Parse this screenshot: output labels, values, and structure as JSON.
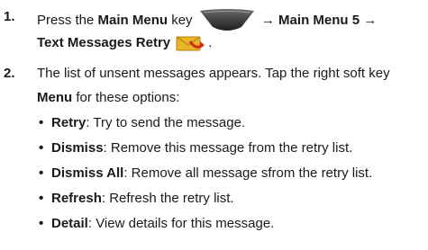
{
  "steps": [
    {
      "number": "1.",
      "press": "Press the ",
      "key_name": "Main Menu",
      "key_word": " key",
      "arrow1": "→ Main Menu 5 →",
      "line2": "Text Messages Retry",
      "icon_main_menu": "main-menu-key-icon",
      "icon_retry": "envelope-retry-icon"
    },
    {
      "number": "2.",
      "line1": "The list of unsent messages appears. Tap the right soft key",
      "menu_label": "Menu",
      "line2_rest": " for these options:"
    }
  ],
  "options": [
    {
      "name": "Retry",
      "desc": ": Try to send the message."
    },
    {
      "name": "Dismiss",
      "desc": ":  Remove this message from the retry list."
    },
    {
      "name": "Dismiss All",
      "desc": ": Remove all message sfrom the retry list."
    },
    {
      "name": "Refresh",
      "desc": ": Refresh the retry list."
    },
    {
      "name": "Detail",
      "desc": ": View details for this message."
    }
  ],
  "colors": {
    "accent": "#d9a520",
    "key": "#3a3a3a",
    "retry_arrow": "#d42a1a"
  }
}
